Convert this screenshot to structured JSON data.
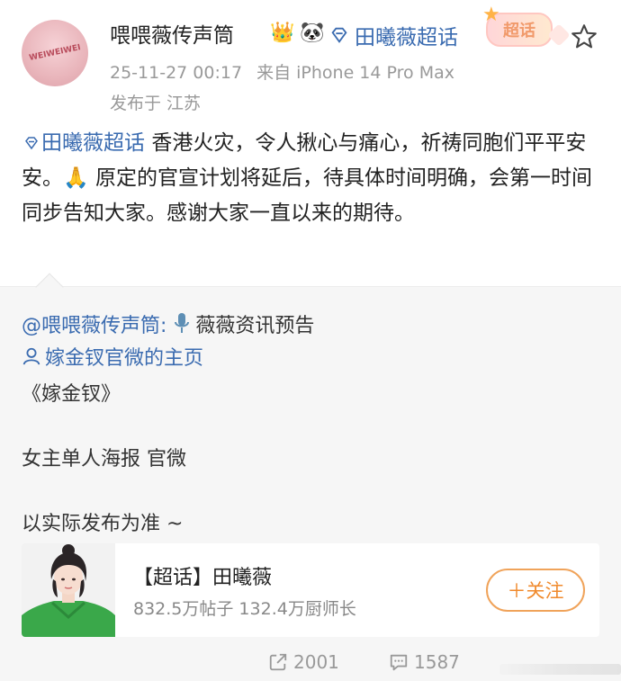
{
  "header": {
    "username": "喂喂薇传声筒",
    "avatar_text": "WEIWEIWEI",
    "topic_link": "田曦薇超话",
    "chaohua_tag": "超话",
    "timestamp": "25-11-27 00:17",
    "source": "来自 iPhone 14 Pro Max",
    "location": "发布于 江苏",
    "badges": [
      "crown-icon",
      "panda-icon"
    ]
  },
  "post": {
    "tag": "田曦薇超话",
    "text": " 香港火灾，令人揪心与痛心，祈祷同胞们平平安安。🙏 原定的官宣计划将延后，待具体时间明确，会第一时间同步告知大家。感谢大家一直以来的期待。"
  },
  "repost": {
    "mention": "@喂喂薇传声筒:",
    "mention_suffix": "薇薇资讯预告",
    "profile_link": "嫁金钗官微的主页",
    "line_title": "《嫁金钗》",
    "line_poster": "女主单人海报 官微",
    "line_note": "以实际发布为准 ~",
    "card": {
      "title": "【超话】田曦薇",
      "stats": "832.5万帖子 132.4万厨师长",
      "follow_label": "＋关注"
    }
  },
  "actions": {
    "share_count": "2001",
    "comment_count": "1587"
  },
  "colors": {
    "link": "#3a6bb0",
    "follow": "#f08a2c",
    "panel": "#f6f6f6"
  }
}
